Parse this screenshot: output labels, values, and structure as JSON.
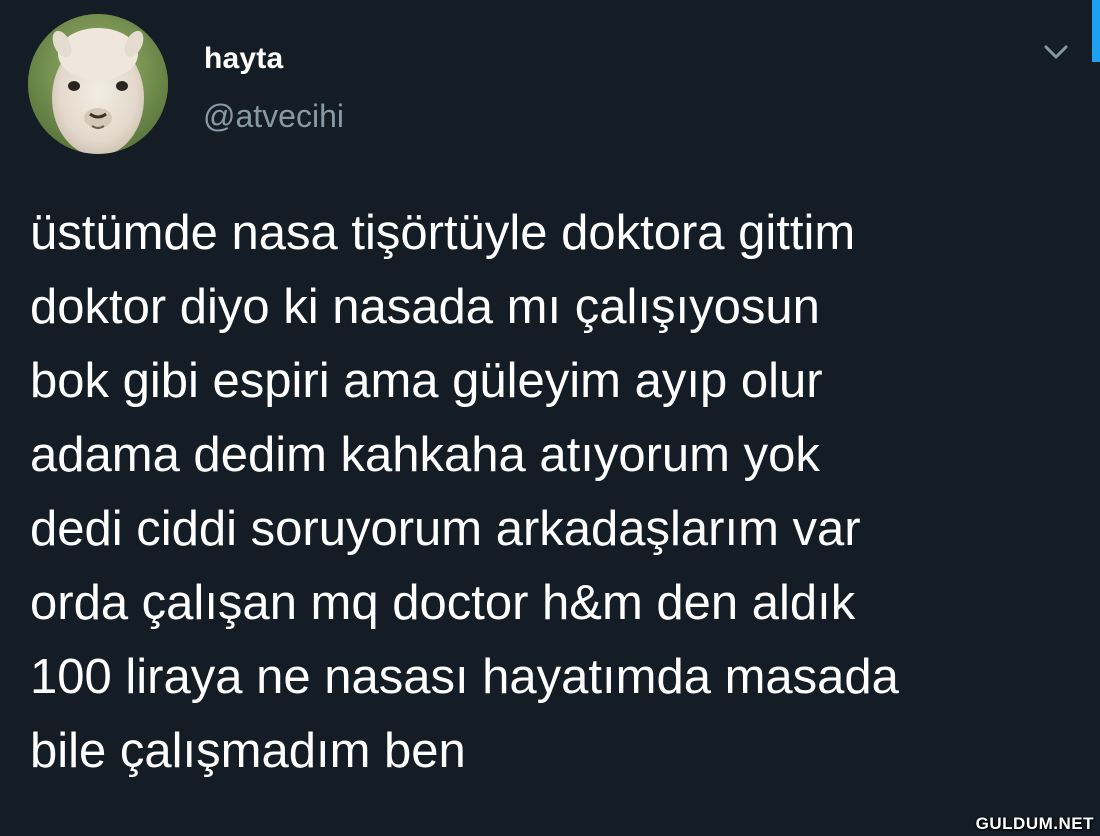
{
  "tweet": {
    "author": {
      "display_name": "hayta",
      "handle": "@atvecihi",
      "avatar_icon": "alpaca-avatar"
    },
    "menu_icon": "chevron-down-icon",
    "text_lines": [
      "üstümde nasa tişörtüyle doktora gittim",
      "doktor diyo ki nasada mı çalışıyosun",
      "bok gibi espiri ama güleyim ayıp olur",
      "adama dedim kahkaha atıyorum yok",
      "dedi ciddi soruyorum arkadaşlarım var",
      "orda çalışan mq doctor h&m den aldık",
      "100 liraya ne nasası hayatımda masada",
      "bile çalışmadım ben"
    ]
  },
  "watermark": "GULDUM.NET",
  "colors": {
    "background": "#141d26",
    "text": "#ffffff",
    "secondary_text": "#8899a6",
    "accent": "#1da1f2"
  }
}
